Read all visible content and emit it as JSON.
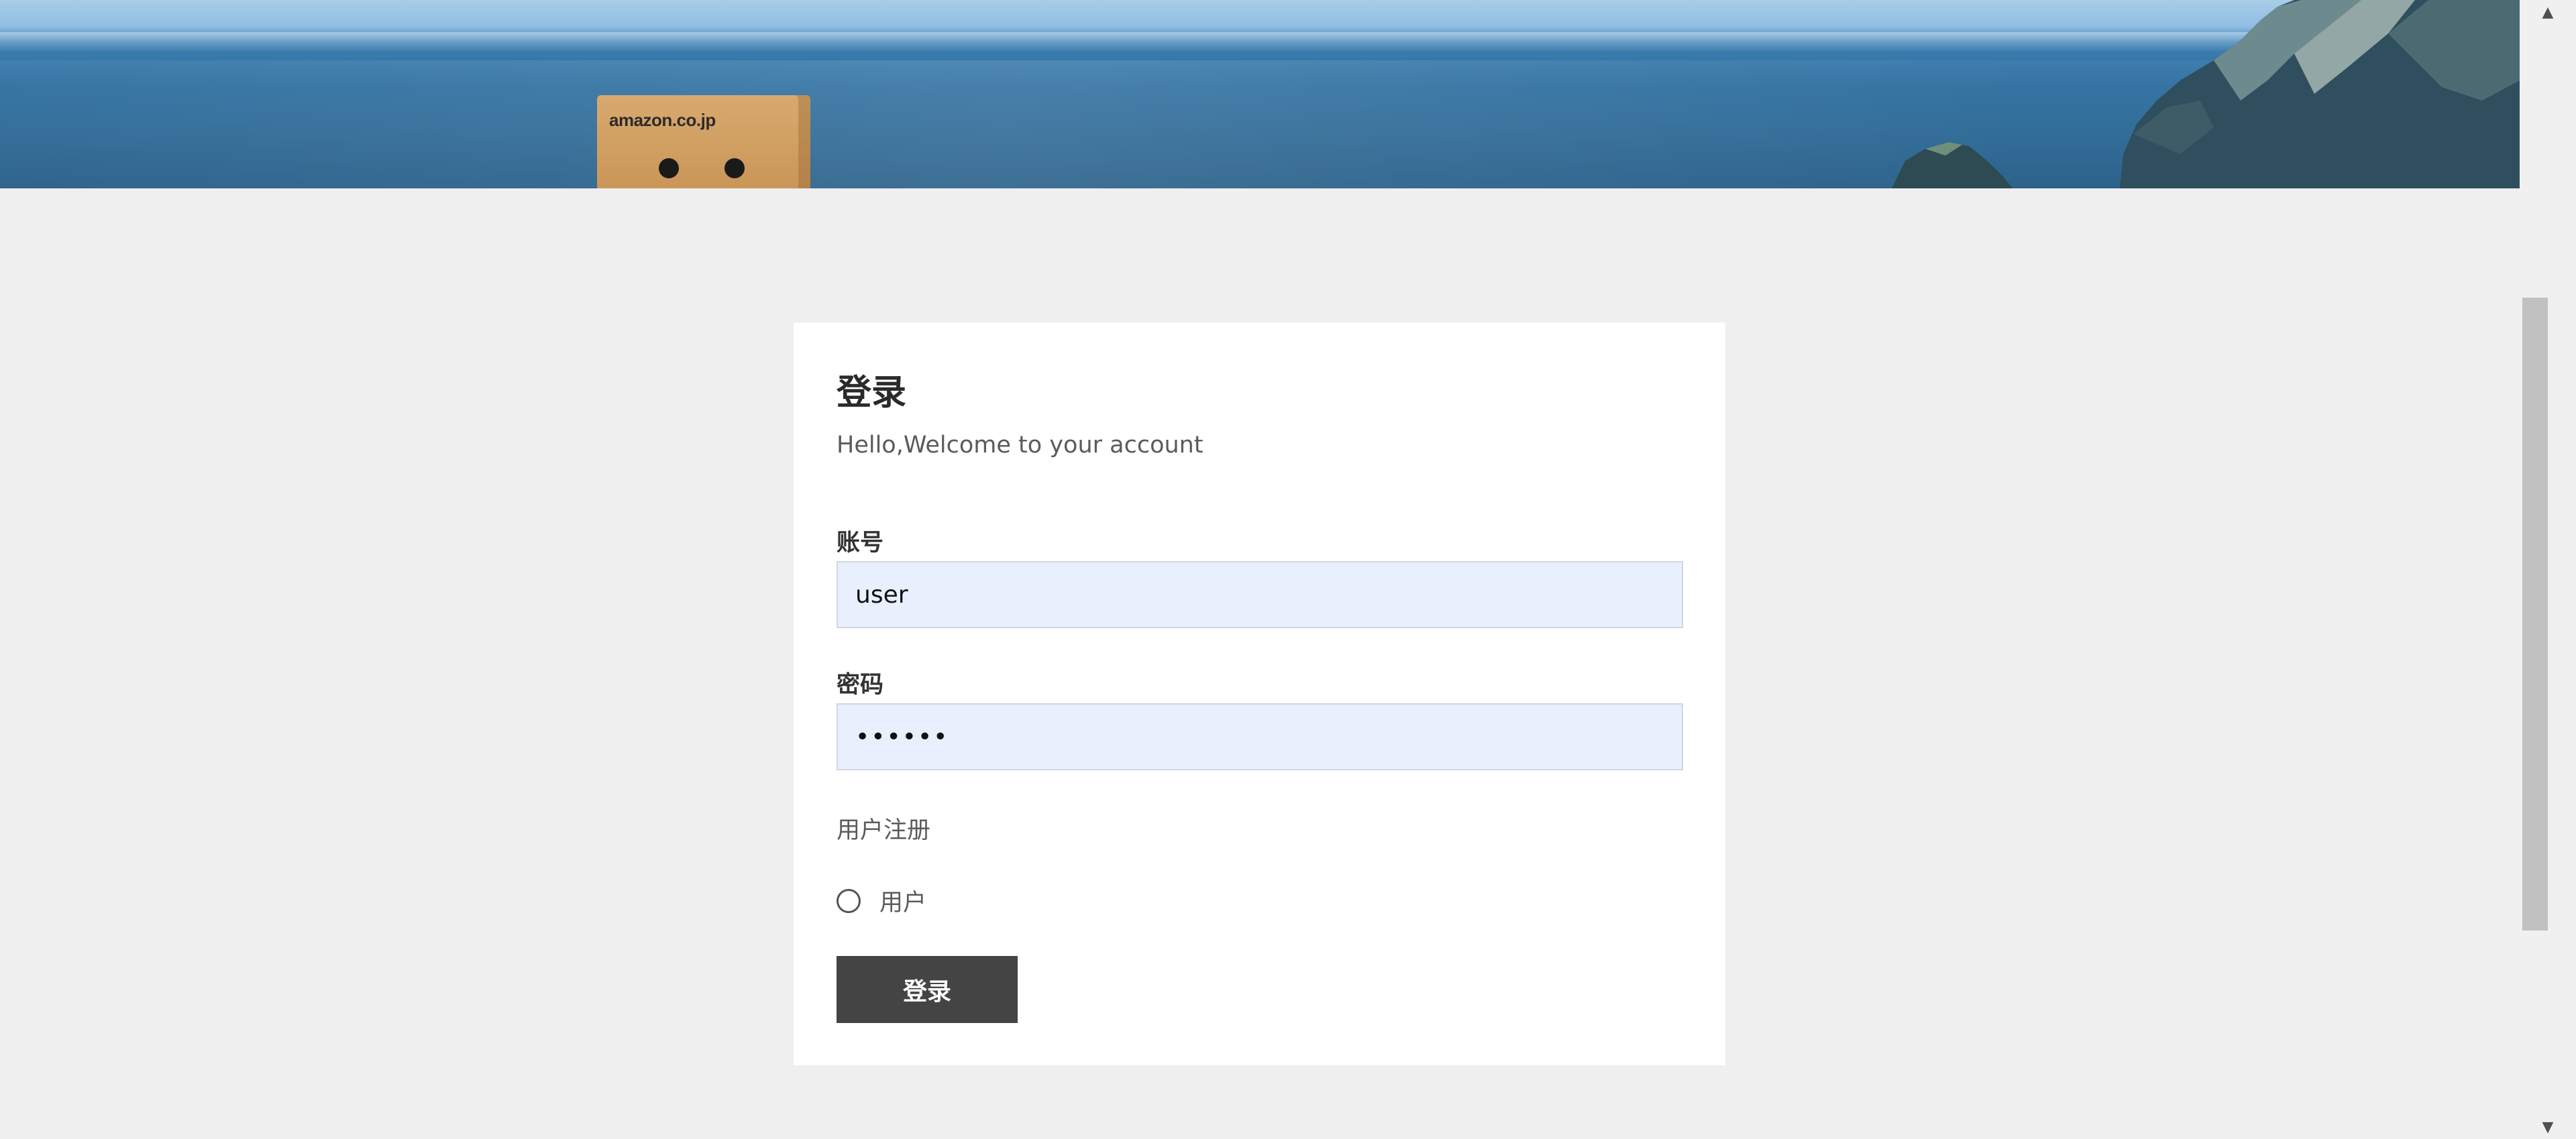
{
  "banner": {
    "box_brand_text": "amazon.co.jp"
  },
  "login": {
    "title": "登录",
    "subtitle": "Hello,Welcome to your account",
    "account_label": "账号",
    "account_value": "user",
    "password_label": "密码",
    "password_value": "••••••",
    "register_label": "用户注册",
    "role_option_label": "用户",
    "role_option_selected": false,
    "submit_label": "登录"
  },
  "scrollbar": {
    "up_icon": "▲",
    "down_icon": "▼"
  },
  "colors": {
    "page_bg": "#efefef",
    "card_bg": "#ffffff",
    "input_bg": "#e8f0fe",
    "button_bg": "#444444",
    "button_text": "#ffffff"
  }
}
